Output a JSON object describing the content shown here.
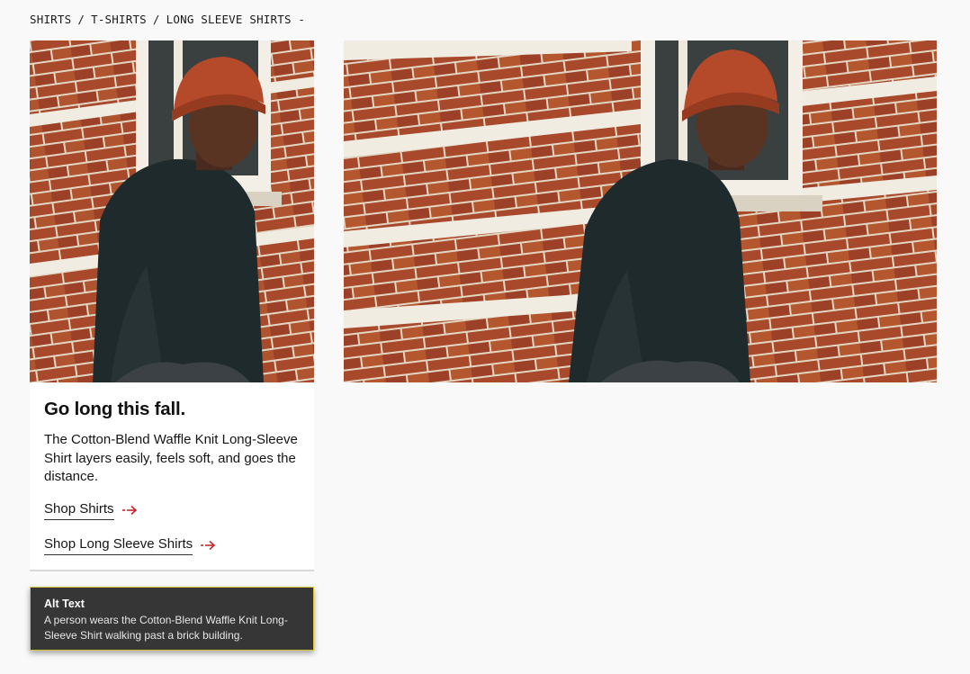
{
  "breadcrumb": {
    "items": [
      "SHIRTS",
      "T-SHIRTS",
      "LONG SLEEVE SHIRTS -"
    ],
    "separator": "/"
  },
  "images": {
    "left_photo": "person-brick-wall-photo",
    "right_photo": "person-brick-wall-photo"
  },
  "card": {
    "title": "Go long this fall.",
    "body": "The Cotton-Blend Waffle Knit Long-Sleeve Shirt layers easily, feels soft, and goes the distance.",
    "links": [
      {
        "label": "Shop Shirts",
        "icon": "arrow-right-icon"
      },
      {
        "label": "Shop Long Sleeve Shirts",
        "icon": "arrow-right-icon"
      }
    ]
  },
  "alt": {
    "title": "Alt Text",
    "text": "A person wears the Cotton-Blend Waffle Knit Long-Sleeve Shirt walking past a brick building."
  },
  "colors": {
    "page_bg": "#f9f9f9",
    "accent_arrow": "#c0282d",
    "alt_bg": "#363636",
    "alt_border": "#d7c335",
    "brick": "#a8492b",
    "mortar": "#e8dfcf",
    "sweater": "#1f2a2c",
    "beanie": "#b44a2a"
  }
}
